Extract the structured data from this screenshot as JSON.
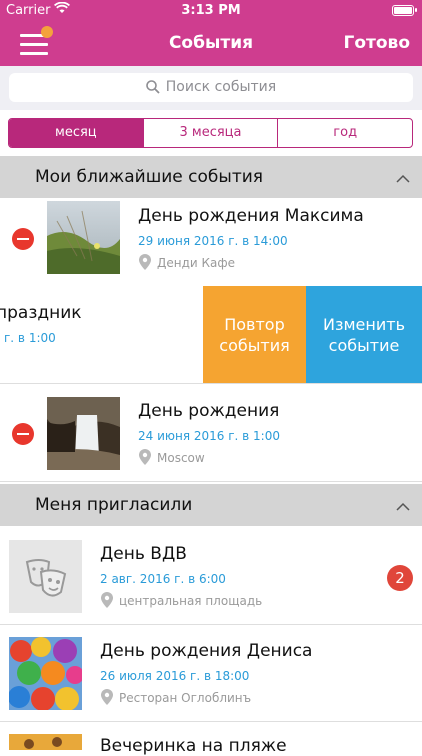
{
  "status": {
    "carrier": "Carrier",
    "time": "3:13 PM"
  },
  "nav": {
    "title": "События",
    "done": "Готово"
  },
  "search": {
    "placeholder": "Поиск события"
  },
  "segments": [
    "месяц",
    "3 месяца",
    "год"
  ],
  "sections": {
    "mine": "Мои ближайшие события",
    "invited": "Меня пригласили"
  },
  "mine_events": [
    {
      "title": "День рождения Максима",
      "date": "29 июня 2016 г. в 14:00",
      "place": "Денди Кафе"
    },
    {
      "title": "праздник",
      "date": "г. в 1:00"
    },
    {
      "title": "День рождения",
      "date": "24 июня 2016 г. в 1:00",
      "place": "Moscow"
    }
  ],
  "swipe_actions": {
    "repeat": "Повтор\nсобытия",
    "edit": "Изменить\nсобытие"
  },
  "invited_events": [
    {
      "title": "День ВДВ",
      "date": "2 авг. 2016 г. в 6:00",
      "place": "центральная площадь",
      "badge": "2"
    },
    {
      "title": "День рождения Дениса",
      "date": "26 июля 2016 г. в 18:00",
      "place": "Ресторан Оглоблинъ"
    },
    {
      "title": "Вечеринка на пляже"
    }
  ],
  "colors": {
    "brand": "#cf3d8f",
    "segment": "#b8287b",
    "date": "#2a9bd8",
    "repeat": "#f5a431",
    "edit": "#2ea4dd",
    "delete": "#e8372d"
  }
}
